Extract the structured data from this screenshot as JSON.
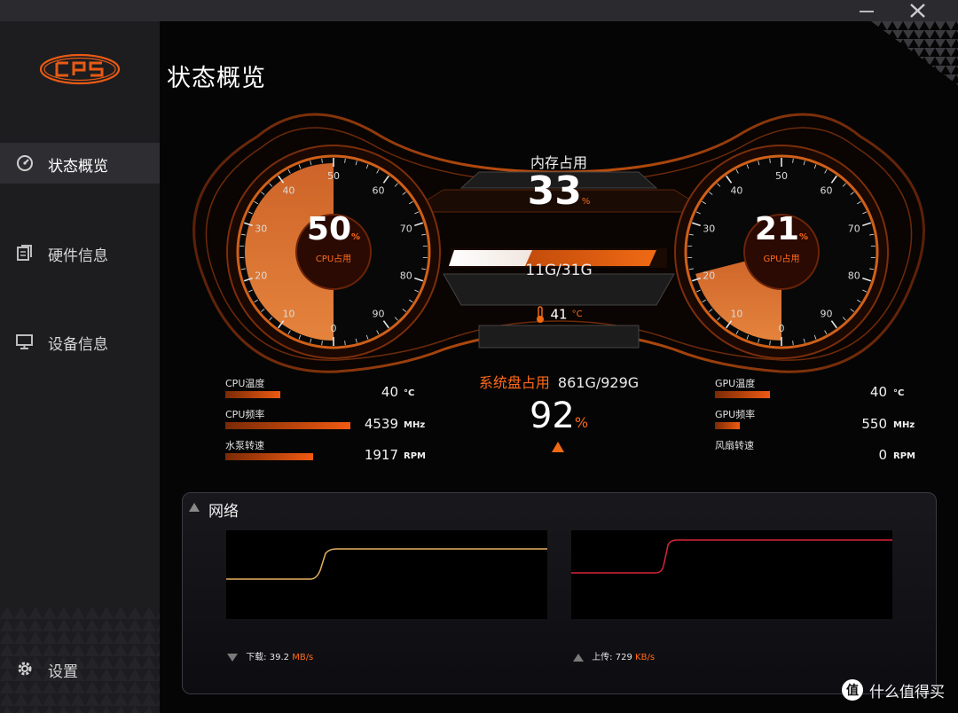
{
  "sidebar": {
    "items": [
      {
        "label": "状态概览",
        "icon": "speedometer-icon"
      },
      {
        "label": "硬件信息",
        "icon": "hardware-icon"
      },
      {
        "label": "设备信息",
        "icon": "monitor-icon"
      }
    ],
    "settings_label": "设置"
  },
  "page_title": "状态概览",
  "cpu_gauge": {
    "value": "50",
    "unit": "%",
    "label": "CPU占用",
    "percent": 50,
    "ticks": [
      "0",
      "10",
      "20",
      "30",
      "40",
      "50",
      "60",
      "70",
      "80",
      "90"
    ]
  },
  "gpu_gauge": {
    "value": "21",
    "unit": "%",
    "label": "GPU占用",
    "percent": 21,
    "ticks": [
      "0",
      "10",
      "20",
      "30",
      "40",
      "50",
      "60",
      "70",
      "80",
      "90"
    ]
  },
  "memory": {
    "title": "内存占用",
    "value": "33",
    "unit": "%",
    "usage": "11G/31G",
    "percent": 33,
    "temp_value": "41",
    "temp_unit": "°C"
  },
  "cpu_stats": [
    {
      "label": "CPU温度",
      "value": "40",
      "unit": "°C",
      "level": 0.45
    },
    {
      "label": "CPU频率",
      "value": "4539",
      "unit": "MHz",
      "level": 1.0
    },
    {
      "label": "水泵转速",
      "value": "1917",
      "unit": "RPM",
      "level": 0.7
    }
  ],
  "gpu_stats": [
    {
      "label": "GPU温度",
      "value": "40",
      "unit": "°C",
      "level": 0.45
    },
    {
      "label": "GPU频率",
      "value": "550",
      "unit": "MHz",
      "level": 0.2
    },
    {
      "label": "风扇转速",
      "value": "0",
      "unit": "RPM",
      "level": 0
    }
  ],
  "disk": {
    "title": "系统盘占用",
    "usage": "861G/929G",
    "value": "92",
    "unit": "%"
  },
  "network": {
    "title": "网络",
    "download": {
      "label": "下载:",
      "value": "39.2",
      "unit": "MB/s"
    },
    "upload": {
      "label": "上传:",
      "value": "729",
      "unit": "KB/s"
    }
  },
  "watermark": "什么值得买",
  "colors": {
    "accent": "#f05a12",
    "panel": "#1d1d20",
    "download_line": "#e8b060",
    "upload_line": "#d8243c"
  }
}
